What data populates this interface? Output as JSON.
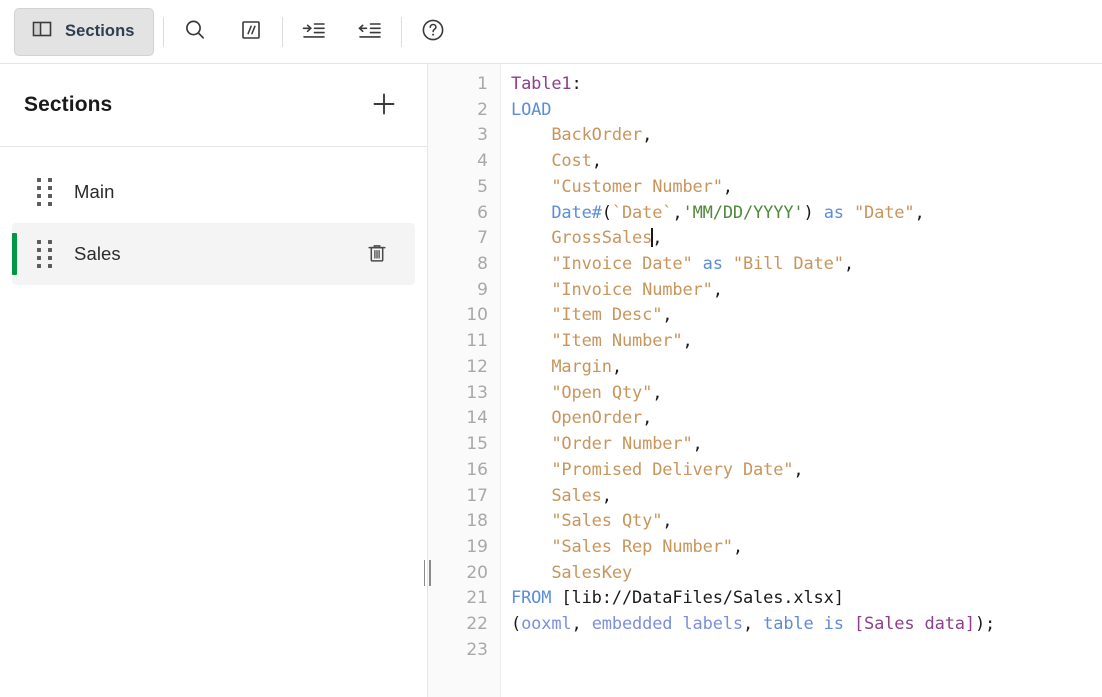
{
  "toolbar": {
    "sections_button": {
      "label": "Sections",
      "icon": "panel-layout-icon",
      "active": true
    },
    "buttons": [
      {
        "name": "search",
        "icon": "search-icon",
        "label": "Search"
      },
      {
        "name": "comment",
        "icon": "comment-slashes-icon",
        "label": "Comment"
      },
      {
        "name": "indent",
        "icon": "indent-increase-icon",
        "label": "Increase indent"
      },
      {
        "name": "outdent",
        "icon": "indent-decrease-icon",
        "label": "Decrease indent"
      },
      {
        "name": "help",
        "icon": "help-circle-icon",
        "label": "Help"
      }
    ]
  },
  "sidebar": {
    "title": "Sections",
    "add_label": "+",
    "add_icon": "plus-icon",
    "accent_color": "#009845",
    "items": [
      {
        "label": "Main",
        "selected": false,
        "drag_icon": "drag-handle-icon"
      },
      {
        "label": "Sales",
        "selected": true,
        "drag_icon": "drag-handle-icon",
        "delete_icon": "trash-icon"
      }
    ]
  },
  "editor": {
    "line_numbers": [
      "1",
      "2",
      "3",
      "4",
      "5",
      "6",
      "7",
      "8",
      "9",
      "10",
      "11",
      "12",
      "13",
      "14",
      "15",
      "16",
      "17",
      "18",
      "19",
      "20",
      "21",
      "22",
      "23"
    ],
    "cursor_line": 7,
    "colors": {
      "table_label": "#8d3f8d",
      "keyword": "#5b8dd9",
      "field": "#c8955c",
      "string": "#4f8a3d",
      "parameter": "#7b8fe0",
      "plain": "#1a1a1a"
    },
    "lines": [
      {
        "n": 1,
        "tokens": [
          {
            "t": "Table1",
            "c": "t-table"
          },
          {
            "t": ":",
            "c": "t-plain"
          }
        ]
      },
      {
        "n": 2,
        "tokens": [
          {
            "t": "LOAD",
            "c": "t-kw"
          }
        ]
      },
      {
        "n": 3,
        "tokens": [
          {
            "t": "    ",
            "c": "t-plain"
          },
          {
            "t": "BackOrder",
            "c": "t-field"
          },
          {
            "t": ",",
            "c": "t-plain"
          }
        ]
      },
      {
        "n": 4,
        "tokens": [
          {
            "t": "    ",
            "c": "t-plain"
          },
          {
            "t": "Cost",
            "c": "t-field"
          },
          {
            "t": ",",
            "c": "t-plain"
          }
        ]
      },
      {
        "n": 5,
        "tokens": [
          {
            "t": "    ",
            "c": "t-plain"
          },
          {
            "t": "\"Customer Number\"",
            "c": "t-field"
          },
          {
            "t": ",",
            "c": "t-plain"
          }
        ]
      },
      {
        "n": 6,
        "tokens": [
          {
            "t": "    ",
            "c": "t-plain"
          },
          {
            "t": "Date#",
            "c": "t-func"
          },
          {
            "t": "(",
            "c": "t-plain"
          },
          {
            "t": "`Date`",
            "c": "t-field"
          },
          {
            "t": ",",
            "c": "t-plain"
          },
          {
            "t": "'MM/DD/YYYY'",
            "c": "t-str"
          },
          {
            "t": ")",
            "c": "t-plain"
          },
          {
            "t": " ",
            "c": "t-plain"
          },
          {
            "t": "as",
            "c": "t-kw"
          },
          {
            "t": " ",
            "c": "t-plain"
          },
          {
            "t": "\"Date\"",
            "c": "t-field"
          },
          {
            "t": ",",
            "c": "t-plain"
          }
        ]
      },
      {
        "n": 7,
        "tokens": [
          {
            "t": "    ",
            "c": "t-plain"
          },
          {
            "t": "GrossSales",
            "c": "t-field"
          },
          {
            "t": "CURSOR",
            "c": "cursor"
          },
          {
            "t": ",",
            "c": "t-plain"
          }
        ]
      },
      {
        "n": 8,
        "tokens": [
          {
            "t": "    ",
            "c": "t-plain"
          },
          {
            "t": "\"Invoice Date\"",
            "c": "t-field"
          },
          {
            "t": " ",
            "c": "t-plain"
          },
          {
            "t": "as",
            "c": "t-kw"
          },
          {
            "t": " ",
            "c": "t-plain"
          },
          {
            "t": "\"Bill Date\"",
            "c": "t-field"
          },
          {
            "t": ",",
            "c": "t-plain"
          }
        ]
      },
      {
        "n": 9,
        "tokens": [
          {
            "t": "    ",
            "c": "t-plain"
          },
          {
            "t": "\"Invoice Number\"",
            "c": "t-field"
          },
          {
            "t": ",",
            "c": "t-plain"
          }
        ]
      },
      {
        "n": 10,
        "tokens": [
          {
            "t": "    ",
            "c": "t-plain"
          },
          {
            "t": "\"Item Desc\"",
            "c": "t-field"
          },
          {
            "t": ",",
            "c": "t-plain"
          }
        ]
      },
      {
        "n": 11,
        "tokens": [
          {
            "t": "    ",
            "c": "t-plain"
          },
          {
            "t": "\"Item Number\"",
            "c": "t-field"
          },
          {
            "t": ",",
            "c": "t-plain"
          }
        ]
      },
      {
        "n": 12,
        "tokens": [
          {
            "t": "    ",
            "c": "t-plain"
          },
          {
            "t": "Margin",
            "c": "t-field"
          },
          {
            "t": ",",
            "c": "t-plain"
          }
        ]
      },
      {
        "n": 13,
        "tokens": [
          {
            "t": "    ",
            "c": "t-plain"
          },
          {
            "t": "\"Open Qty\"",
            "c": "t-field"
          },
          {
            "t": ",",
            "c": "t-plain"
          }
        ]
      },
      {
        "n": 14,
        "tokens": [
          {
            "t": "    ",
            "c": "t-plain"
          },
          {
            "t": "OpenOrder",
            "c": "t-field"
          },
          {
            "t": ",",
            "c": "t-plain"
          }
        ]
      },
      {
        "n": 15,
        "tokens": [
          {
            "t": "    ",
            "c": "t-plain"
          },
          {
            "t": "\"Order Number\"",
            "c": "t-field"
          },
          {
            "t": ",",
            "c": "t-plain"
          }
        ]
      },
      {
        "n": 16,
        "tokens": [
          {
            "t": "    ",
            "c": "t-plain"
          },
          {
            "t": "\"Promised Delivery Date\"",
            "c": "t-field"
          },
          {
            "t": ",",
            "c": "t-plain"
          }
        ]
      },
      {
        "n": 17,
        "tokens": [
          {
            "t": "    ",
            "c": "t-plain"
          },
          {
            "t": "Sales",
            "c": "t-field"
          },
          {
            "t": ",",
            "c": "t-plain"
          }
        ]
      },
      {
        "n": 18,
        "tokens": [
          {
            "t": "    ",
            "c": "t-plain"
          },
          {
            "t": "\"Sales Qty\"",
            "c": "t-field"
          },
          {
            "t": ",",
            "c": "t-plain"
          }
        ]
      },
      {
        "n": 19,
        "tokens": [
          {
            "t": "    ",
            "c": "t-plain"
          },
          {
            "t": "\"Sales Rep Number\"",
            "c": "t-field"
          },
          {
            "t": ",",
            "c": "t-plain"
          }
        ]
      },
      {
        "n": 20,
        "tokens": [
          {
            "t": "    ",
            "c": "t-plain"
          },
          {
            "t": "SalesKey",
            "c": "t-field"
          }
        ]
      },
      {
        "n": 21,
        "tokens": [
          {
            "t": "FROM",
            "c": "t-kw"
          },
          {
            "t": " [lib://DataFiles/Sales.xlsx]",
            "c": "t-plain"
          }
        ]
      },
      {
        "n": 22,
        "tokens": [
          {
            "t": "(",
            "c": "t-plain"
          },
          {
            "t": "ooxml",
            "c": "t-param"
          },
          {
            "t": ", ",
            "c": "t-plain"
          },
          {
            "t": "embedded labels",
            "c": "t-param"
          },
          {
            "t": ", ",
            "c": "t-plain"
          },
          {
            "t": "table is",
            "c": "t-kw"
          },
          {
            "t": " ",
            "c": "t-plain"
          },
          {
            "t": "[Sales data]",
            "c": "t-table"
          },
          {
            "t": ");",
            "c": "t-plain"
          }
        ]
      },
      {
        "n": 23,
        "tokens": []
      }
    ]
  }
}
